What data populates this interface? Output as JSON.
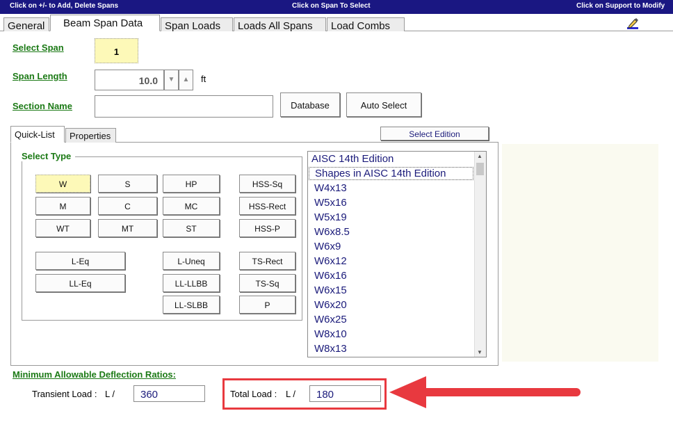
{
  "topbar": {
    "left": "Click on  +/-  to Add, Delete Spans",
    "center": "Click on Span To Select",
    "right": "Click on Support to Modify"
  },
  "tabs": [
    "General",
    "Beam Span Data",
    "Span Loads",
    "Loads All Spans",
    "Load Combs"
  ],
  "form": {
    "select_span_label": "Select Span",
    "select_span_value": "1",
    "span_length_label": "Span Length",
    "span_length_value": "10.0",
    "span_length_unit": "ft",
    "section_name_label": "Section Name",
    "section_name_value": "",
    "database_button": "Database",
    "auto_select_button": "Auto Select"
  },
  "subtabs": [
    "Quick-List",
    "Properties"
  ],
  "select_edition_button": "Select Edition",
  "select_type": {
    "label": "Select Type",
    "buttons": [
      "W",
      "S",
      "HP",
      "HSS-Sq",
      "M",
      "C",
      "MC",
      "HSS-Rect",
      "WT",
      "MT",
      "ST",
      "HSS-P",
      "L-Eq",
      "L-Uneq",
      "TS-Rect",
      "LL-Eq",
      "LL-LLBB",
      "TS-Sq",
      "LL-SLBB",
      "P"
    ],
    "selected": "W"
  },
  "shape_list": {
    "header": "AISC 14th Edition",
    "items": [
      "Shapes in AISC 14th Edition",
      "W4x13",
      "W5x16",
      "W5x19",
      "W6x8.5",
      "W6x9",
      "W6x12",
      "W6x16",
      "W6x15",
      "W6x20",
      "W6x25",
      "W8x10",
      "W8x13"
    ]
  },
  "deflection": {
    "title": "Minimum Allowable Deflection Ratios:",
    "transient_label": "Transient Load :",
    "transient_prefix": "L /",
    "transient_value": "360",
    "total_label": "Total Load :",
    "total_prefix": "L /",
    "total_value": "180"
  },
  "colors": {
    "title_bar": "#1a1782",
    "label_green": "#1c7a16",
    "highlight_red": "#e8393f",
    "selected_yellow": "#fdf9b8"
  }
}
